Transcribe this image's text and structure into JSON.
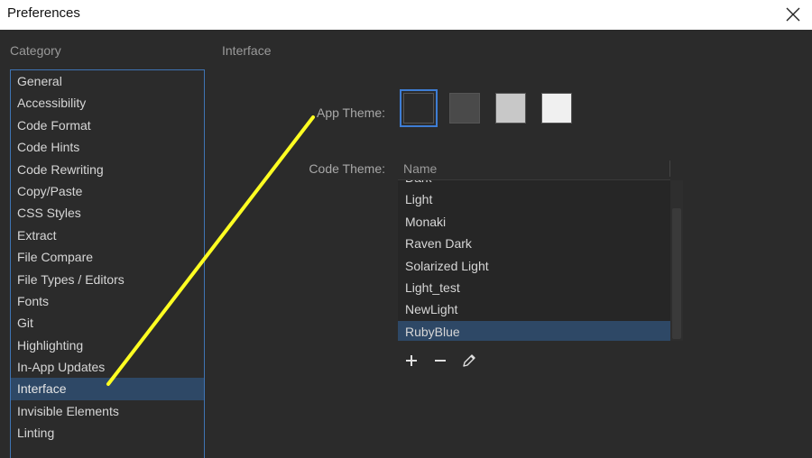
{
  "window": {
    "title": "Preferences"
  },
  "category": {
    "header": "Category",
    "items": [
      "General",
      "Accessibility",
      "Code Format",
      "Code Hints",
      "Code Rewriting",
      "Copy/Paste",
      "CSS Styles",
      "Extract",
      "File Compare",
      "File Types / Editors",
      "Fonts",
      "Git",
      "Highlighting",
      "In-App Updates",
      "Interface",
      "Invisible Elements",
      "Linting"
    ],
    "selected": "Interface"
  },
  "interface": {
    "header": "Interface",
    "app_theme_label": "App Theme:",
    "app_theme_swatches": [
      {
        "color": "#2b2b2b",
        "selected": true
      },
      {
        "color": "#4a4a4a",
        "selected": false
      },
      {
        "color": "#c8c8c8",
        "selected": false
      },
      {
        "color": "#f0f0f0",
        "selected": false
      }
    ],
    "code_theme_label": "Code Theme:",
    "code_theme_column": "Name",
    "code_themes": [
      "Dark",
      "Light",
      "Monaki",
      "Raven Dark",
      "Solarized Light",
      "Light_test",
      "NewLight",
      "RubyBlue"
    ],
    "selected_code_theme": "RubyBlue",
    "actions": {
      "add_icon": "plus-icon",
      "remove_icon": "minus-icon",
      "edit_icon": "pencil-icon"
    }
  },
  "colors": {
    "accent": "#3e7dd4",
    "selection": "#2e4866",
    "annotation": "#ffff22"
  }
}
